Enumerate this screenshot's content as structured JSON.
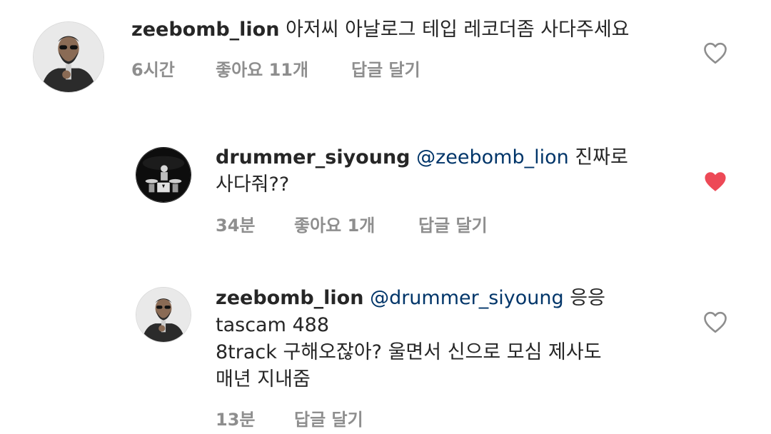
{
  "comments": [
    {
      "username": "zeebomb_lion",
      "mention": "",
      "lines": [
        "아저씨 아날로그 테입 레코더좀 사다주세요"
      ],
      "time": "6시간",
      "likes": "좋아요 11개",
      "reply": "답글 달기",
      "liked": false,
      "avatar_icon": "bearded-man-sunglasses-avatar"
    },
    {
      "username": "drummer_siyoung",
      "mention": "@zeebomb_lion",
      "lines": [
        "진짜로",
        "사다줘??"
      ],
      "time": "34분",
      "likes": "좋아요 1개",
      "reply": "답글 달기",
      "liked": true,
      "avatar_icon": "drummer-on-stage-avatar"
    },
    {
      "username": "zeebomb_lion",
      "mention": "@drummer_siyoung",
      "lines": [
        "응응",
        "tascam 488",
        "8track 구해오잖아? 울면서 신으로 모심  제사도",
        "매년 지내줌"
      ],
      "time": "13분",
      "likes": "",
      "reply": "답글 달기",
      "liked": false,
      "avatar_icon": "bearded-man-sunglasses-avatar"
    }
  ],
  "colors": {
    "text": "#262626",
    "mention": "#003569",
    "meta": "#8e8e8e",
    "heart_liked": "#ed4956",
    "heart_outline": "#8e8e8e"
  }
}
